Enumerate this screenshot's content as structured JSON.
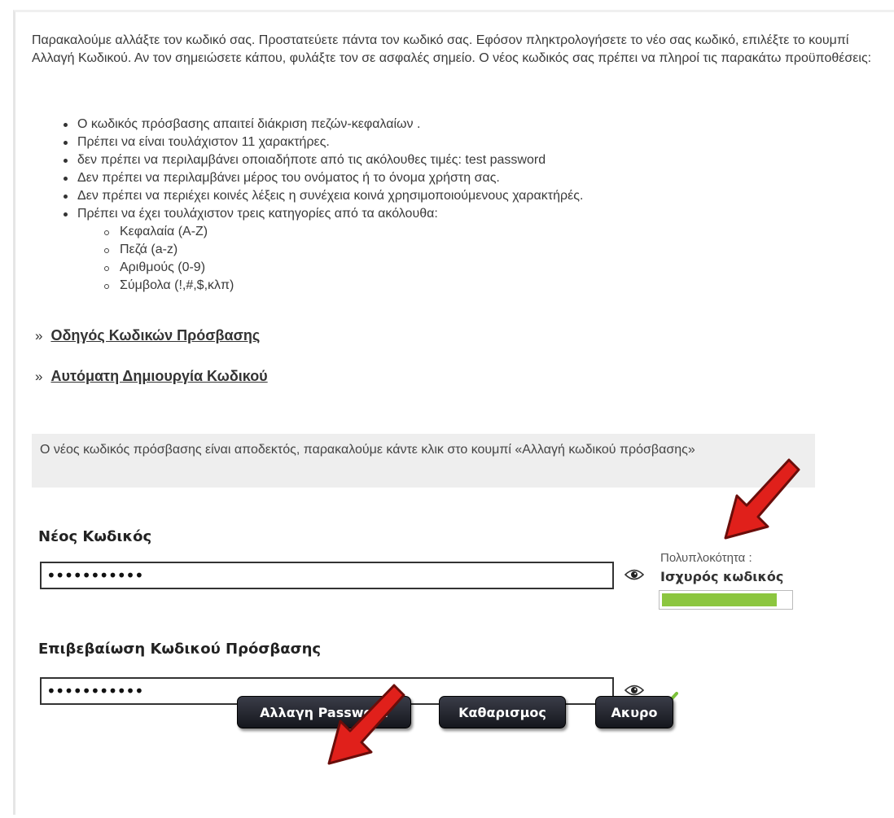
{
  "intro": "Παρακαλούμε αλλάξτε τον κωδικό σας. Προστατεύετε πάντα τον κωδικό σας. Εφόσον πληκτρολογήσετε το νέο σας κωδικό, επιλέξτε το κουμπί Αλλαγή Κωδικού. Αν τον σημειώσετε κάπου, φυλάξτε τον σε ασφαλές σημείο. Ο νέος κωδικός σας πρέπει να πληροί τις παρακάτω προϋποθέσεις:",
  "rules": [
    "Ο κωδικός πρόσβασης απαιτεί διάκριση πεζών-κεφαλαίων .",
    "Πρέπει να είναι τουλάχιστον 11 χαρακτήρες.",
    "δεν πρέπει να περιλαμβάνει οποιαδήποτε από τις ακόλουθες τιμές: test password",
    "Δεν πρέπει να περιλαμβάνει μέρος του ονόματος ή το όνομα χρήστη σας.",
    "Δεν πρέπει να περιέχει κοινές λέξεις η συνέχεια κοινά χρησιμοποιούμενους χαρακτήρές.",
    "Πρέπει να έχει τουλάχιστον τρεις κατηγορίες από τα ακόλουθα:"
  ],
  "categories": [
    "Κεφαλαία (A-Z)",
    "Πεζά (a-z)",
    "Αριθμούς (0-9)",
    "Σύμβολα (!,#,$,κλπ)"
  ],
  "links": {
    "bullet": "»",
    "guide": "Οδηγός Κωδικών Πρόσβασης",
    "autogen": "Αυτόματη Δημιουργία Κωδικού"
  },
  "notice": "Ο νέος κωδικός πρόσβασης είναι αποδεκτός, παρακαλούμε κάντε κλικ στο κουμπί «Αλλαγή κωδικού πρόσβασης»",
  "new_password": {
    "label": "Νέος Κωδικός",
    "value": "•••••••••••"
  },
  "confirm_password": {
    "label": "Επιβεβαίωση Κωδικού Πρόσβασης",
    "value": "•••••••••••"
  },
  "strength": {
    "caption": "Πολυπλοκότητα :",
    "value": "Ισχυρός κωδικός",
    "level": 0.9,
    "color": "#8cc63f"
  },
  "buttons": {
    "change": "Αλλαγη Password",
    "clear": "Καθαρισμος",
    "cancel": "Ακυρο"
  },
  "icons": {
    "show_password": "eye-icon",
    "match": "checkmark-icon",
    "annotation": "red-arrow"
  },
  "colors": {
    "arrow": "#e0201b",
    "button_bg": "#1f2128",
    "notice_bg": "#eeeeee"
  }
}
